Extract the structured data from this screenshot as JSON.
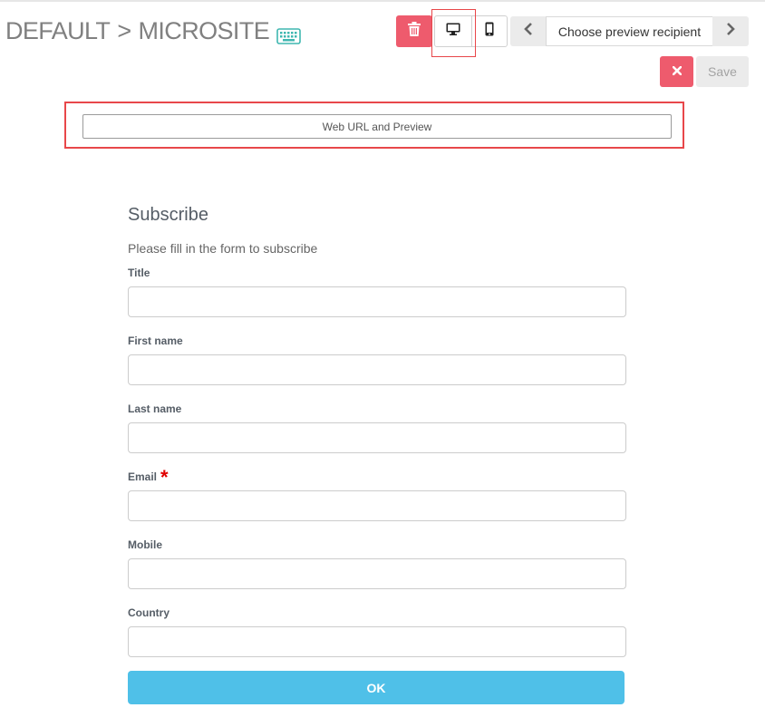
{
  "header": {
    "breadcrumb_root": "DEFAULT",
    "breadcrumb_separator": ">",
    "breadcrumb_current": "MICROSITE",
    "icons": {
      "breadcrumb": "keyboard-icon",
      "delete": "trash-icon",
      "desktop": "desktop-monitor-icon",
      "mobile": "mobile-phone-icon",
      "prev": "chevron-left-icon",
      "next": "chevron-right-icon",
      "cancel": "close-icon"
    }
  },
  "toolbar": {
    "recipient_label": "Choose preview recipient",
    "save_label": "Save"
  },
  "web_url_button": {
    "label": "Web URL and Preview"
  },
  "form": {
    "title": "Subscribe",
    "description": "Please fill in the form to subscribe",
    "fields": [
      {
        "label": "Title",
        "required": false
      },
      {
        "label": "First name",
        "required": false
      },
      {
        "label": "Last name",
        "required": false
      },
      {
        "label": "Email",
        "required": true,
        "required_marker": "*"
      },
      {
        "label": "Mobile",
        "required": false
      },
      {
        "label": "Country",
        "required": false
      }
    ],
    "submit_label": "OK"
  },
  "colors": {
    "danger": "#ee5b6d",
    "primary": "#4fc0e8",
    "highlight": "#e8474a",
    "keyboard_icon": "#3fb7b0"
  }
}
